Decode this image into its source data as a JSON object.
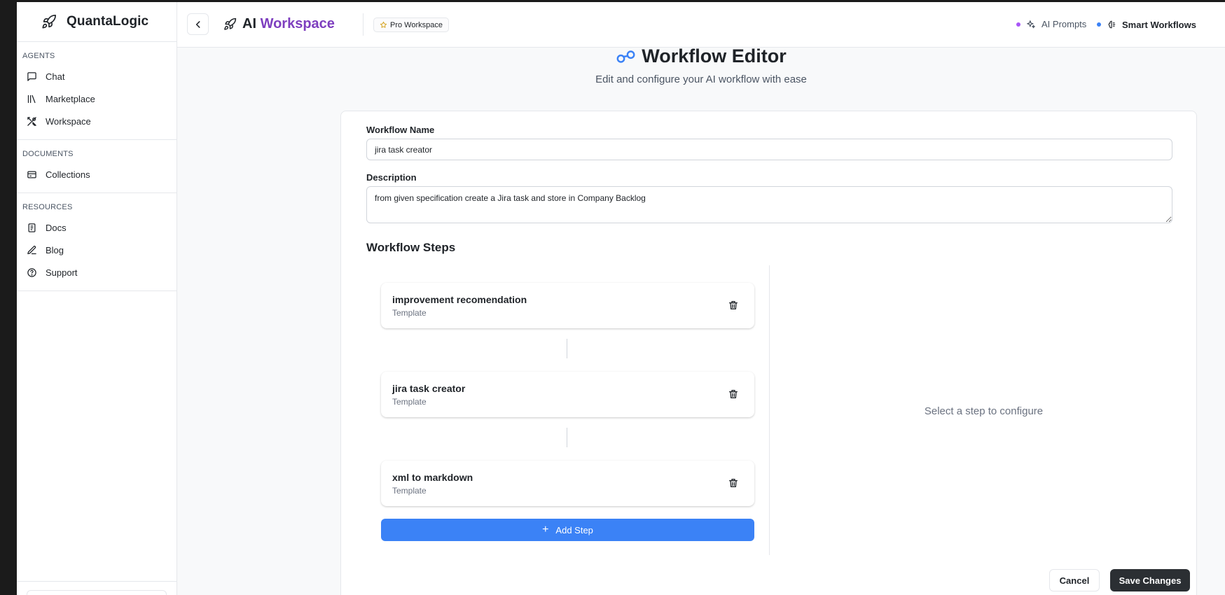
{
  "brand": {
    "name": "QuantaLogic",
    "icon": "rocket-icon"
  },
  "sidebar": {
    "sections": [
      {
        "heading": "AGENTS",
        "items": [
          {
            "label": "Chat",
            "icon": "chat-bubble-icon"
          },
          {
            "label": "Marketplace",
            "icon": "library-icon"
          },
          {
            "label": "Workspace",
            "icon": "tools-icon"
          }
        ]
      },
      {
        "heading": "DOCUMENTS",
        "items": [
          {
            "label": "Collections",
            "icon": "collection-icon"
          }
        ]
      },
      {
        "heading": "RESOURCES",
        "items": [
          {
            "label": "Docs",
            "icon": "document-icon"
          },
          {
            "label": "Blog",
            "icon": "pen-icon"
          },
          {
            "label": "Support",
            "icon": "help-circle-icon"
          }
        ]
      }
    ]
  },
  "header": {
    "title_prefix": "AI ",
    "title_accent": "Workspace",
    "badge": "Pro Workspace",
    "links": [
      {
        "label": "AI Prompts",
        "dot_color": "#a855f7"
      },
      {
        "label": "Smart Workflows",
        "dot_color": "#3b82f6"
      }
    ]
  },
  "editor": {
    "title": "Workflow Editor",
    "subtitle": "Edit and configure your AI workflow with ease",
    "name_label": "Workflow Name",
    "name_value": "jira task creator",
    "description_label": "Description",
    "description_value": "from given specification create a Jira task and store in Company Backlog",
    "steps_heading": "Workflow Steps",
    "steps": [
      {
        "title": "improvement recomendation",
        "type": "Template"
      },
      {
        "title": "jira task creator",
        "type": "Template"
      },
      {
        "title": "xml to markdown",
        "type": "Template"
      }
    ],
    "add_step_label": "Add Step",
    "config_placeholder": "Select a step to configure",
    "cancel_label": "Cancel",
    "save_label": "Save Changes"
  },
  "colors": {
    "accent_purple": "#7e3fbf",
    "primary_blue": "#3b82f6",
    "dark_button": "#2b2f33"
  }
}
